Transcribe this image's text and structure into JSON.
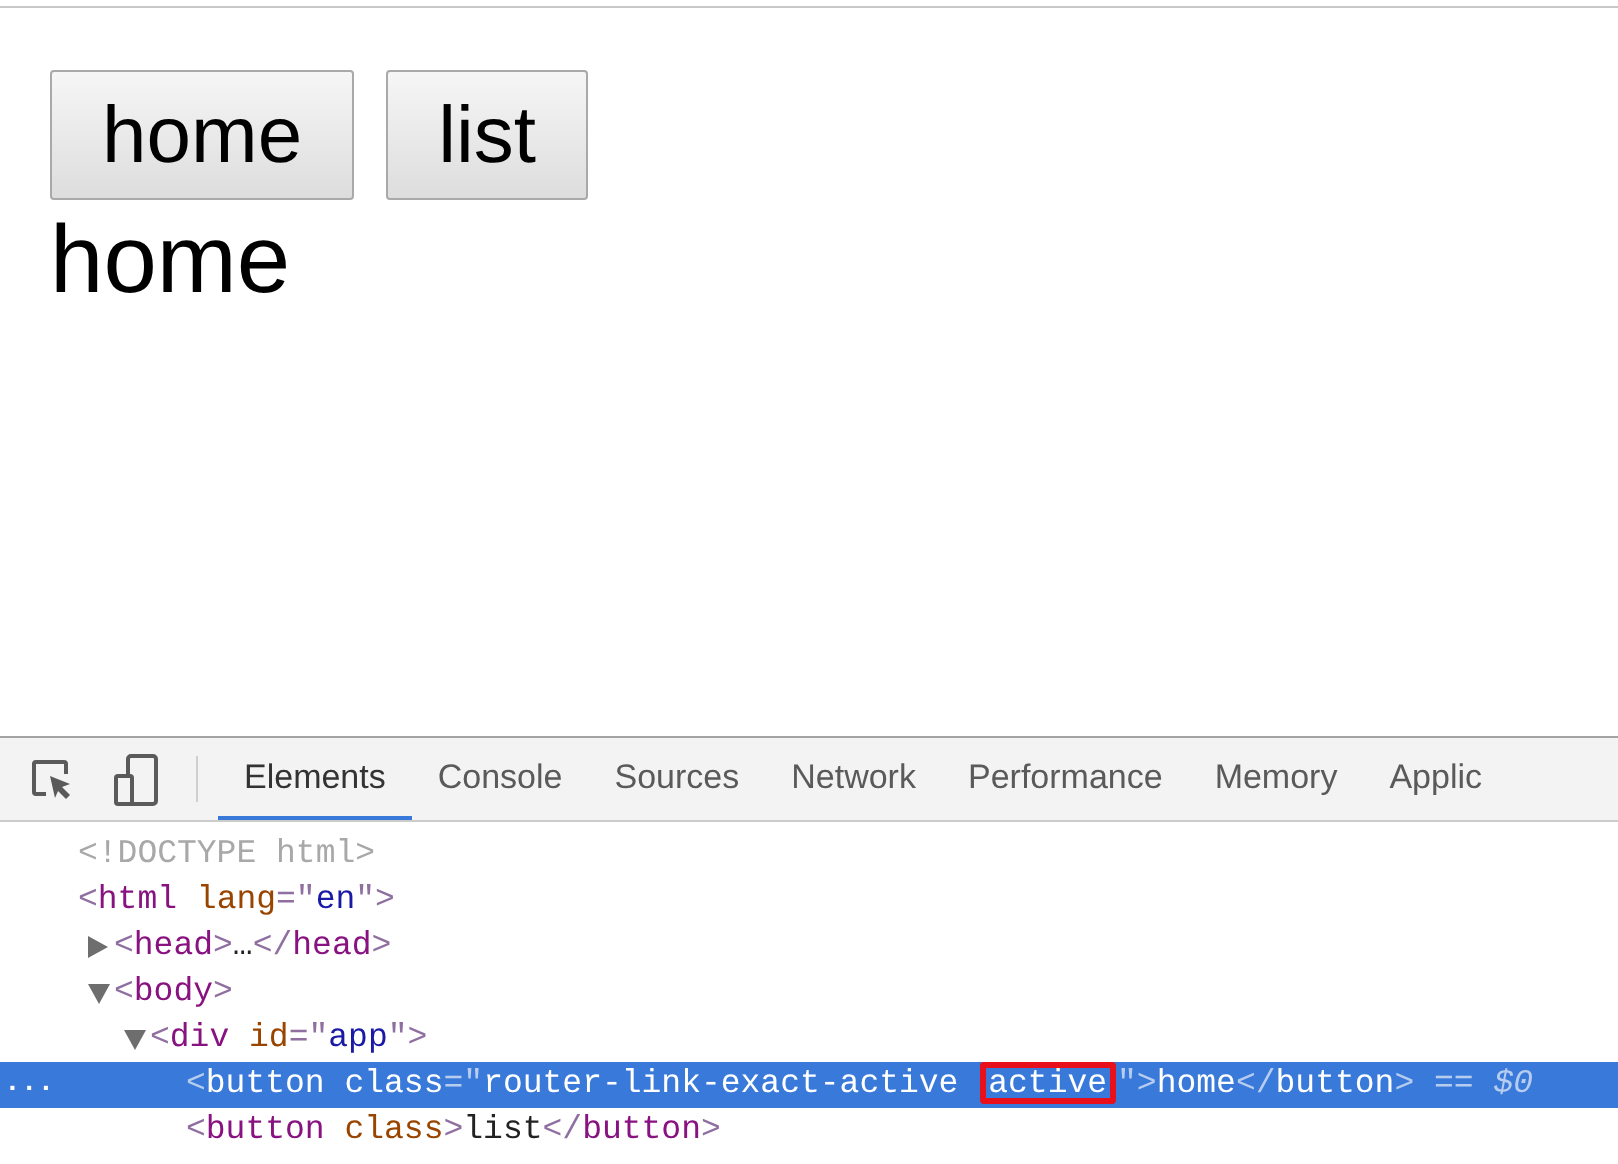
{
  "page": {
    "nav_buttons": [
      {
        "label": "home"
      },
      {
        "label": "list"
      }
    ],
    "view_text": "home"
  },
  "devtools": {
    "tabs": [
      {
        "label": "Elements",
        "selected": true
      },
      {
        "label": "Console",
        "selected": false
      },
      {
        "label": "Sources",
        "selected": false
      },
      {
        "label": "Network",
        "selected": false
      },
      {
        "label": "Performance",
        "selected": false
      },
      {
        "label": "Memory",
        "selected": false
      },
      {
        "label": "Applic",
        "selected": false
      }
    ],
    "row_menu": "...",
    "dom_tree": [
      {
        "selected": false,
        "tokens": [
          {
            "kind": "doctype",
            "text": "<!DOCTYPE html>"
          }
        ]
      },
      {
        "selected": false,
        "tokens": [
          {
            "kind": "bracket",
            "text": "<"
          },
          {
            "kind": "tag",
            "text": "html"
          },
          {
            "kind": "attr",
            "text": " lang"
          },
          {
            "kind": "bracket",
            "text": "=\""
          },
          {
            "kind": "value",
            "text": "en"
          },
          {
            "kind": "bracket",
            "text": "\">"
          }
        ],
        "children": [
          {
            "expanded": false,
            "selected": false,
            "tokens": [
              {
                "kind": "bracket",
                "text": "<"
              },
              {
                "kind": "tag",
                "text": "head"
              },
              {
                "kind": "bracket",
                "text": ">"
              },
              {
                "kind": "text",
                "text": "…"
              },
              {
                "kind": "bracket",
                "text": "</"
              },
              {
                "kind": "tag",
                "text": "head"
              },
              {
                "kind": "bracket",
                "text": ">"
              }
            ]
          },
          {
            "expanded": true,
            "selected": false,
            "tokens": [
              {
                "kind": "bracket",
                "text": "<"
              },
              {
                "kind": "tag",
                "text": "body"
              },
              {
                "kind": "bracket",
                "text": ">"
              }
            ],
            "children": [
              {
                "expanded": true,
                "selected": false,
                "tokens": [
                  {
                    "kind": "bracket",
                    "text": "<"
                  },
                  {
                    "kind": "tag",
                    "text": "div"
                  },
                  {
                    "kind": "attr",
                    "text": " id"
                  },
                  {
                    "kind": "bracket",
                    "text": "=\""
                  },
                  {
                    "kind": "value",
                    "text": "app"
                  },
                  {
                    "kind": "bracket",
                    "text": "\">"
                  }
                ],
                "children": [
                  {
                    "selected": true,
                    "tokens": [
                      {
                        "kind": "bracket",
                        "text": "<"
                      },
                      {
                        "kind": "tag",
                        "text": "button"
                      },
                      {
                        "kind": "attr",
                        "text": " class"
                      },
                      {
                        "kind": "bracket",
                        "text": "=\""
                      },
                      {
                        "kind": "value",
                        "text": "router-link-exact-active "
                      },
                      {
                        "kind": "value",
                        "text": "active",
                        "boxed": true
                      },
                      {
                        "kind": "bracket",
                        "text": "\">"
                      },
                      {
                        "kind": "text",
                        "text": "home"
                      },
                      {
                        "kind": "bracket",
                        "text": "</"
                      },
                      {
                        "kind": "tag",
                        "text": "button"
                      },
                      {
                        "kind": "bracket",
                        "text": ">"
                      },
                      {
                        "kind": "marker",
                        "text": " == $0"
                      }
                    ]
                  },
                  {
                    "selected": false,
                    "tokens": [
                      {
                        "kind": "bracket",
                        "text": "<"
                      },
                      {
                        "kind": "tag",
                        "text": "button"
                      },
                      {
                        "kind": "attr",
                        "text": " class"
                      },
                      {
                        "kind": "bracket",
                        "text": ">"
                      },
                      {
                        "kind": "text",
                        "text": "list"
                      },
                      {
                        "kind": "bracket",
                        "text": "</"
                      },
                      {
                        "kind": "tag",
                        "text": "button"
                      },
                      {
                        "kind": "bracket",
                        "text": ">"
                      }
                    ]
                  }
                ]
              }
            ]
          }
        ]
      }
    ]
  }
}
